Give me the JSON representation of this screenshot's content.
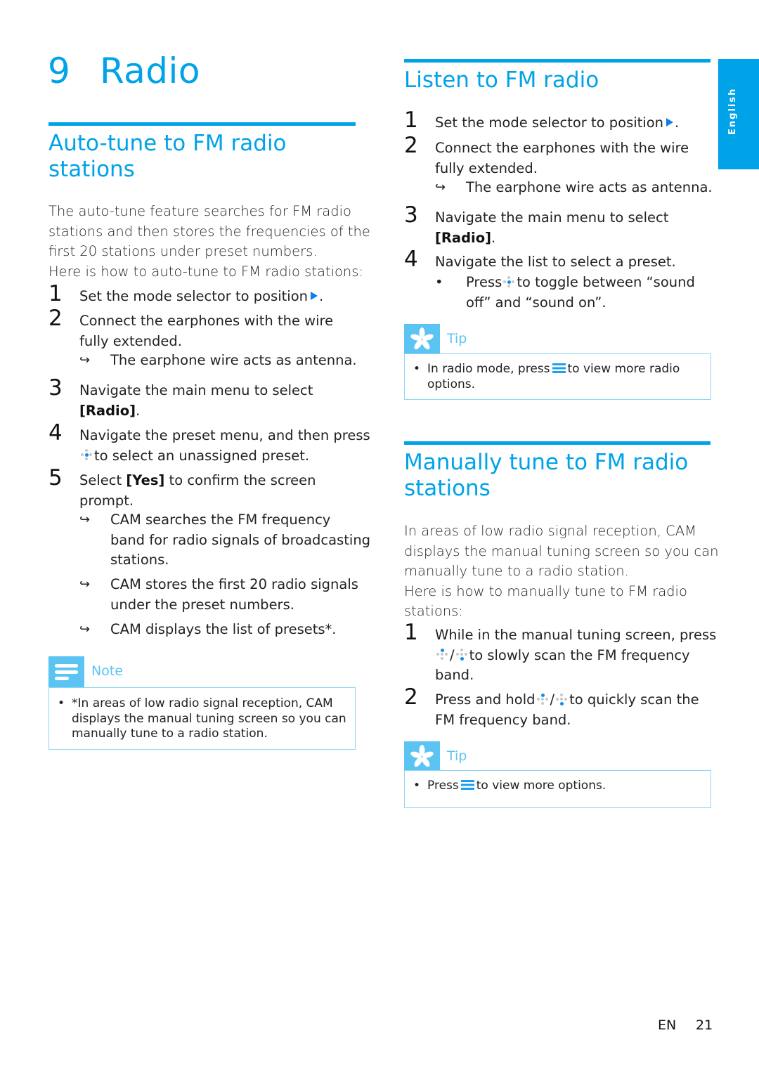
{
  "chapter": {
    "number": "9",
    "title": "Radio"
  },
  "side_tab": {
    "label": "English"
  },
  "left": {
    "heading_lines": [
      "Auto-tune to FM radio",
      "stations"
    ],
    "intro_lines": [
      "The auto-tune feature searches for FM radio",
      "stations and then stores the frequencies of the",
      "first 20 stations under preset numbers.",
      "Here is how to auto-tune to FM radio stations:"
    ],
    "steps": [
      {
        "num": "1",
        "text": "Set the mode selector to position",
        "suffix": "."
      },
      {
        "num": "2",
        "lines": [
          "Connect the earphones with the wire",
          "fully extended."
        ]
      },
      {
        "num": "3",
        "line1": "Navigate the main menu to select",
        "bold": "[Radio]",
        "suffix": "."
      },
      {
        "num": "4",
        "line1": "Navigate the preset menu, and then press",
        "line2": "to select an unassigned preset."
      },
      {
        "num": "5",
        "pre": "Select ",
        "bold": "[Yes]",
        "post": " to confirm the screen",
        "line2": "prompt."
      }
    ],
    "results": {
      "step2": "The earphone wire acts as antenna.",
      "step5": [
        [
          "CAM searches the FM frequency",
          "band for radio signals of broadcasting",
          "stations."
        ],
        [
          "CAM stores the first 20 radio signals",
          "under the preset numbers."
        ],
        [
          "CAM displays the list of presets*."
        ]
      ]
    },
    "note": {
      "label": "Note",
      "lines": [
        "*In areas of low radio signal reception, CAM",
        "displays the manual tuning screen so you can",
        "manually tune to a radio station."
      ]
    }
  },
  "right": {
    "listen": {
      "heading": "Listen to FM radio",
      "steps": [
        {
          "num": "1",
          "text": "Set the mode selector to position",
          "suffix": "."
        },
        {
          "num": "2",
          "lines": [
            "Connect the earphones with the wire",
            "fully extended."
          ]
        },
        {
          "num": "3",
          "line1": "Navigate the main menu to select",
          "bold": "[Radio]",
          "suffix": "."
        },
        {
          "num": "4",
          "text": "Navigate the list to select a preset."
        }
      ],
      "result2": "The earphone wire acts as antenna.",
      "bullet4": {
        "pre": "Press",
        "post": "to toggle between “sound",
        "line2": "off” and “sound on”."
      },
      "tip": {
        "label": "Tip",
        "pre": "In radio mode, press",
        "post": "to view more radio",
        "line2": "options."
      }
    },
    "manual": {
      "heading_lines": [
        "Manually tune to FM radio",
        "stations"
      ],
      "intro_lines": [
        "In areas of low radio signal reception, CAM",
        "displays the manual tuning screen so you can",
        "manually tune to a radio station.",
        "Here is how to manually tune to FM radio",
        "stations:"
      ],
      "steps": [
        {
          "num": "1",
          "line1": "While in the manual tuning screen, press",
          "sep": "/",
          "line2_post": "to slowly scan the FM frequency",
          "line3": "band."
        },
        {
          "num": "2",
          "pre": "Press and hold",
          "sep": "/",
          "post": "to quickly scan the",
          "line2": "FM frequency band."
        }
      ],
      "tip": {
        "label": "Tip",
        "pre": "Press",
        "post": "to view more options."
      }
    }
  },
  "footer": {
    "lang": "EN",
    "page": "21"
  },
  "colors": {
    "accent": "#00a3e8",
    "box_head": "#5bc4f2",
    "box_border": "#8fd6f6"
  }
}
